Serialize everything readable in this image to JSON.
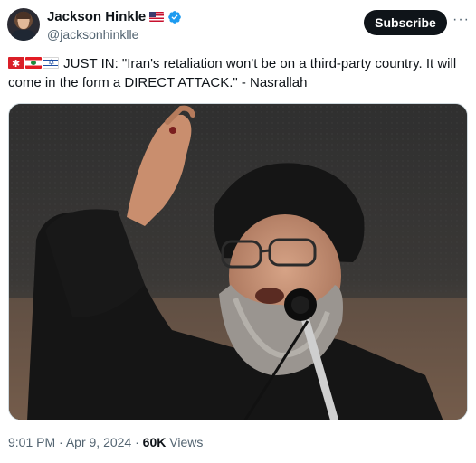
{
  "author": {
    "display_name": "Jackson Hinkle",
    "handle": "@jacksonhinklle",
    "name_flag": "us-flag-icon",
    "verified": true
  },
  "actions": {
    "subscribe_label": "Subscribe",
    "more_label": "···"
  },
  "tweet": {
    "flags": [
      "iran-symbol-flag",
      "lebanon-flag",
      "israel-flag"
    ],
    "text": " JUST IN: \"Iran's retaliation won't be on a third-party country. It will come in the form a DIRECT ATTACK.\" - Nasrallah"
  },
  "media": {
    "description_icon": "speaker-photo"
  },
  "meta": {
    "time": "9:01 PM",
    "separator": "·",
    "date": "Apr 9, 2024",
    "views_count": "60K",
    "views_label": "Views"
  },
  "colors": {
    "text_primary": "#0f1419",
    "text_secondary": "#536471",
    "verified_blue": "#1d9bf0",
    "button_bg": "#0f1419"
  }
}
